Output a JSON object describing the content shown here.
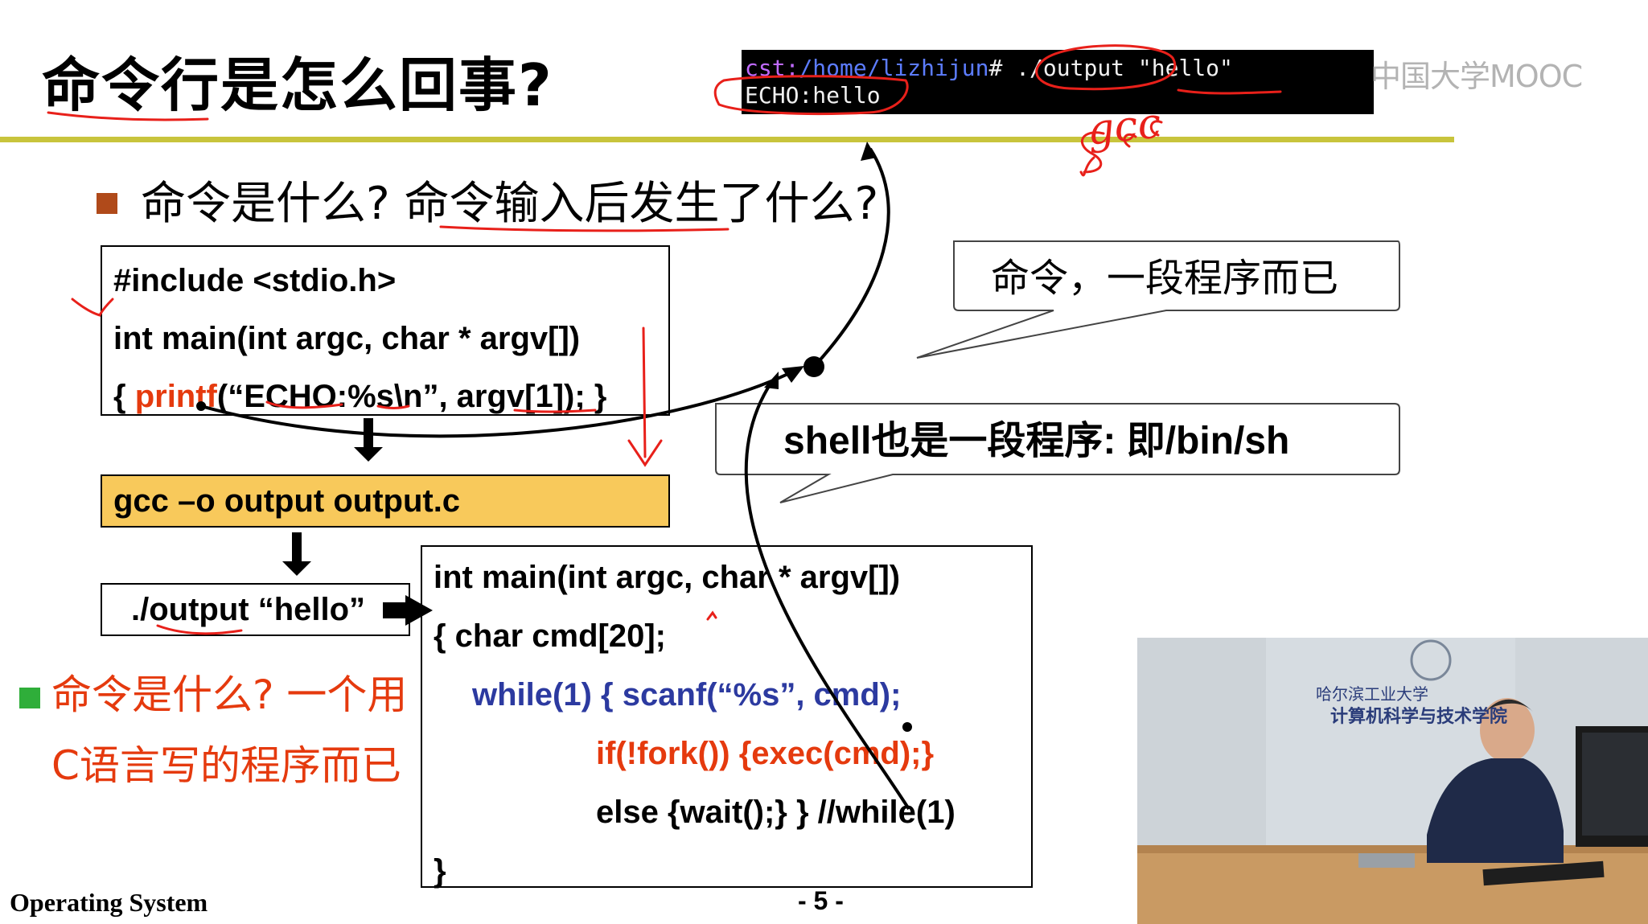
{
  "slide": {
    "title": "命令行是怎么回事?",
    "bullet1": "命令是什么? 命令输入后发生了什么?",
    "code1": [
      "#include <stdio.h>",
      "int main(int argc, char * argv[])",
      {
        "prefix": "{  ",
        "func": "printf",
        "rest": "(“ECHO:%s\\n”, argv[1]); }"
      }
    ],
    "gcc_command": "gcc –o output output.c",
    "run_command": "./output “hello”",
    "code2": [
      "int main(int argc, char * argv[])",
      "{  char cmd[20];",
      "while(1)  { scanf(“%s”, cmd);",
      "if(!fork()) {exec(cmd);}",
      "else {wait();}  }  //while(1)",
      "}"
    ],
    "bubble1": "命令，一段程序而已",
    "bubble2": "shell也是一段程序: 即/bin/sh",
    "bullet2_line1": "命令是什么? 一个用",
    "bullet2_line2": "C语言写的程序而已",
    "footer_left": "Operating System",
    "page_number": "- 5 -"
  },
  "terminal": {
    "prompt_user": "cst:",
    "prompt_path": "/home/lizhijun",
    "prompt_symbol": "#",
    "command": " ./output ",
    "argument": "\"hello\"",
    "output": "ECHO:hello"
  },
  "overlay": {
    "mooc_logo": "中国大学MOOC",
    "handwriting": "gcc"
  },
  "webcam": {
    "banner_text": "计算机科学与技术学院",
    "banner_top": "哈尔滨工业大学"
  },
  "colors": {
    "title_rule": "#c8c43c",
    "highlight_red": "#e53a0e",
    "code_navy": "#2c3aa0",
    "gcc_box_fill": "#f8c95b",
    "annotation_red": "#e8201a"
  }
}
